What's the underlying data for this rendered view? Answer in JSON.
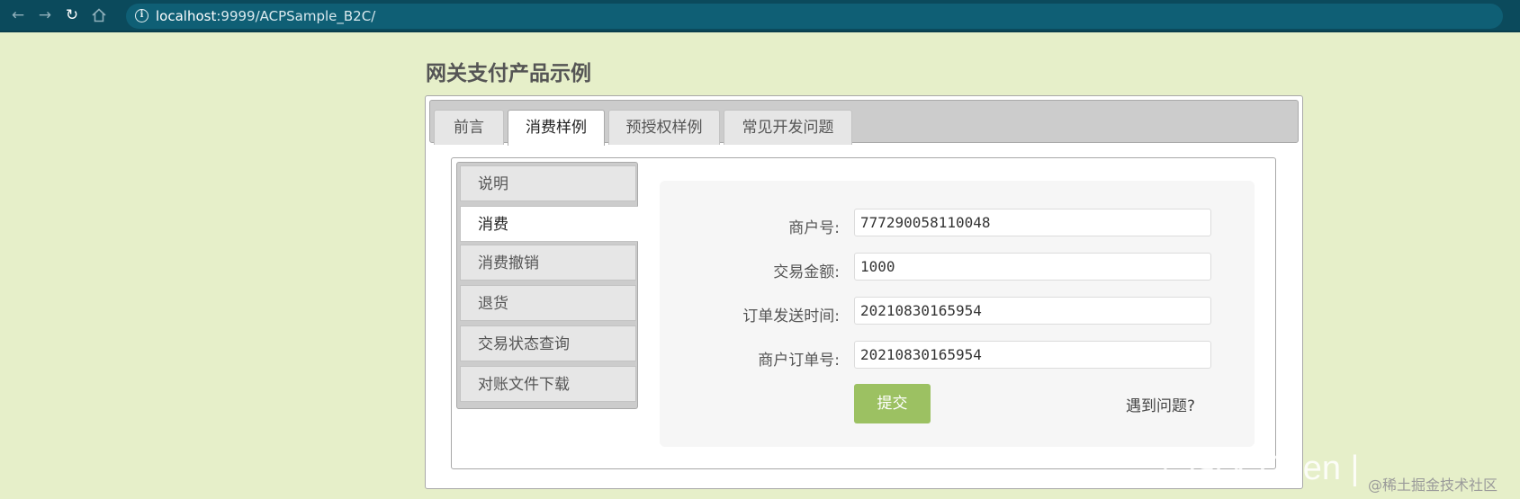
{
  "browser": {
    "back_icon": "arrow-left-icon",
    "forward_icon": "arrow-right-icon",
    "reload_icon": "reload-icon",
    "home_icon": "home-icon",
    "url_host": "localhost",
    "url_rest": ":9999/ACPSample_B2C/"
  },
  "page": {
    "title": "网关支付产品示例"
  },
  "top_tabs": [
    {
      "label": "前言",
      "active": false
    },
    {
      "label": "消费样例",
      "active": true
    },
    {
      "label": "预授权样例",
      "active": false
    },
    {
      "label": "常见开发问题",
      "active": false
    }
  ],
  "side_tabs": [
    {
      "label": "说明",
      "active": false
    },
    {
      "label": "消费",
      "active": true
    },
    {
      "label": "消费撤销",
      "active": false
    },
    {
      "label": "退货",
      "active": false
    },
    {
      "label": "交易状态查询",
      "active": false
    },
    {
      "label": "对账文件下载",
      "active": false
    }
  ],
  "form": {
    "fields": [
      {
        "label": "商户号:",
        "value": "777290058110048"
      },
      {
        "label": "交易金额:",
        "value": "1000"
      },
      {
        "label": "订单发送时间:",
        "value": "20210830165954"
      },
      {
        "label": "商户订单号:",
        "value": "20210830165954"
      }
    ],
    "submit_label": "提交",
    "help_label": "遇到问题?"
  },
  "colors": {
    "page_bg": "#e6efc9",
    "browser_bar": "#0b4a5c",
    "submit_button": "#9cc162"
  },
  "watermark": {
    "brand": "| Jack Chen |",
    "community": "@稀土掘金技术社区"
  }
}
